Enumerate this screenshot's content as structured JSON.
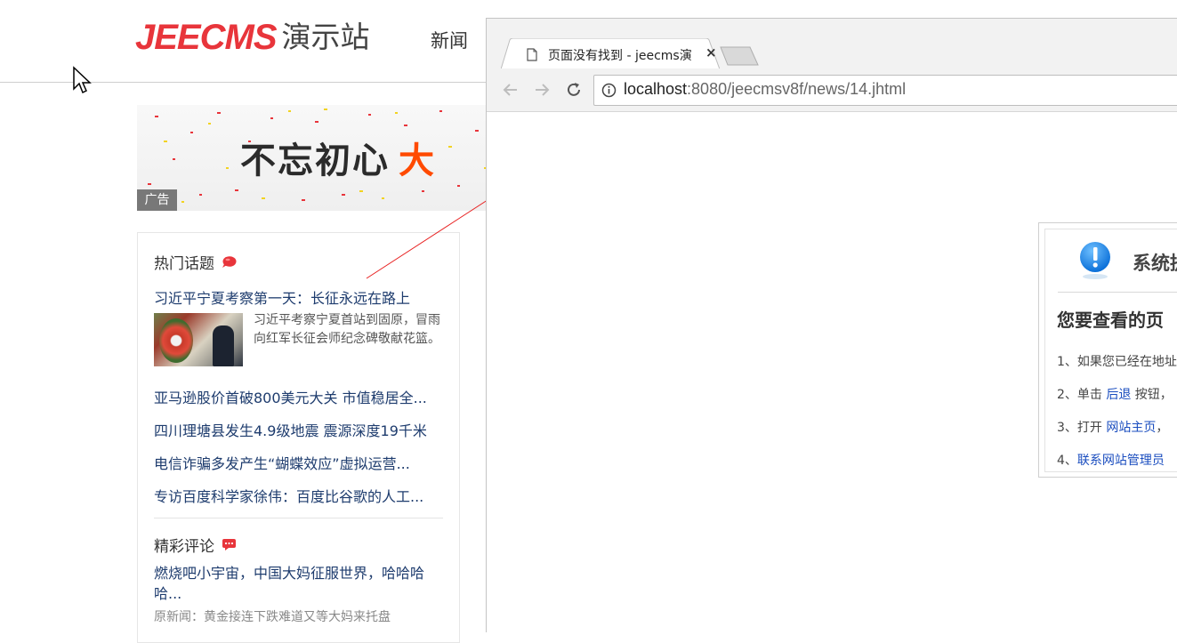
{
  "site": {
    "logo_en": "JEECMS",
    "logo_cn": "演示站",
    "nav_item": "新闻"
  },
  "ad": {
    "text_main": "不忘初心",
    "text_highlight": "大",
    "tag": "广告"
  },
  "hot_topics": {
    "title": "热门话题",
    "headline": "习近平宁夏考察第一天：长征永远在路上",
    "summary": "习近平考察宁夏首站到固原，冒雨向红军长征会师纪念碑敬献花篮。",
    "items": [
      "亚马逊股价首破800美元大关 市值稳居全...",
      "四川理塘县发生4.9级地震 震源深度19千米",
      "电信诈骗多发产生“蝴蝶效应”虚拟运营...",
      "专访百度科学家徐伟：百度比谷歌的人工..."
    ]
  },
  "comments": {
    "title": "精彩评论",
    "headline": "燃烧吧小宇宙，中国大妈征服世界，哈哈哈哈...",
    "original": "原新闻：黄金接连下跌难道又等大妈来托盘"
  },
  "browser": {
    "tab_title": "页面没有找到 - jeecms演",
    "tab_close": "×",
    "url_host": "localhost",
    "url_rest": ":8080/jeecmsv8f/news/14.jhtml"
  },
  "error_page": {
    "title": "系统提",
    "subtitle": "您要查看的页",
    "line1": "1、如果您已经在地址",
    "line2_prefix": "2、单击 ",
    "line2_link": "后退",
    "line2_suffix": " 按钮，",
    "line3_prefix": "3、打开 ",
    "line3_link": "网站主页",
    "line3_suffix": "，",
    "line4_prefix": "4、",
    "line4_link": "联系网站管理员"
  },
  "colors": {
    "logo_red": "#e8353b",
    "link_blue": "#1e3c6e",
    "ad_highlight": "#ff4a00",
    "annotation_line": "#e82020"
  }
}
